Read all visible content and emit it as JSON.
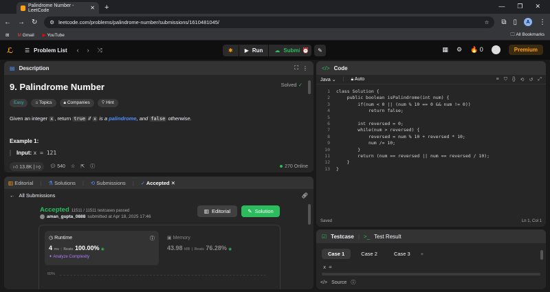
{
  "browser": {
    "tab_title": "Palindrome Number - LeetCode",
    "url": "leetcode.com/problems/palindrome-number/submissions/1610481045/",
    "profile_initial": "A"
  },
  "bookmarks": {
    "items": [
      "Gmail",
      "YouTube"
    ],
    "all": "All Bookmarks"
  },
  "nav": {
    "problem_list": "Problem List",
    "run": "Run",
    "submit": "Submit",
    "fire_count": "0",
    "premium": "Premium"
  },
  "description": {
    "tab": "Description",
    "title": "9. Palindrome Number",
    "status": "Solved",
    "tags": [
      "Easy",
      "Topics",
      "Companies",
      "Hint"
    ],
    "text_before": "Given an integer",
    "var_x": "x",
    "text_mid": ", return",
    "val_true": "true",
    "text_if": "if",
    "var_x2": "x",
    "text_is": "is a",
    "link": "palindrome",
    "text_and": ", and",
    "val_false": "false",
    "text_end": "otherwise.",
    "example_title": "Example 1:",
    "input_label": "Input:",
    "input_value": "x = 121",
    "likes": "13.8K",
    "comments": "540",
    "online": "270 Online"
  },
  "submission": {
    "tabs": [
      "Editorial",
      "Solutions",
      "Submissions",
      "Accepted"
    ],
    "back": "All Submissions",
    "status": "Accepted",
    "testcases": "11511 / 11511 testcases passed",
    "user": "aman_gupta_0888",
    "submitted": "submitted at Apr 18, 2025 17:46",
    "editorial_btn": "Editorial",
    "solution_btn": "Solution",
    "runtime_label": "Runtime",
    "runtime_value": "4",
    "runtime_unit": "ms",
    "beats_label": "Beats",
    "runtime_beats": "100.00%",
    "analyze": "Analyze Complexity",
    "memory_label": "Memory",
    "memory_value": "43.98",
    "memory_unit": "MB",
    "memory_beats": "76.28%",
    "pct_label": "60%"
  },
  "code": {
    "tab": "Code",
    "language": "Java",
    "mode": "Auto",
    "saved": "Saved",
    "cursor": "Ln 1, Col 1",
    "lines": [
      "class Solution {",
      "    public boolean isPalindrome(int num) {",
      "        if(num < 0 || (num % 10 == 0 && num != 0))",
      "            return false;",
      "",
      "        int reversed = 0;",
      "        while(num > reversed) {",
      "            reversed = num % 10 + reversed * 10;",
      "            num /= 10;",
      "        }",
      "        return (num == reversed || num == reversed / 10);",
      "    }",
      "}"
    ]
  },
  "testcase": {
    "tab": "Testcase",
    "result_tab": "Test Result",
    "cases": [
      "Case 1",
      "Case 2",
      "Case 3"
    ],
    "var_label": "x =",
    "source": "Source"
  },
  "colors": {
    "accent": "#ffa116",
    "green": "#2cbb5d",
    "bg": "#1a1a1a",
    "panel": "#262626"
  }
}
